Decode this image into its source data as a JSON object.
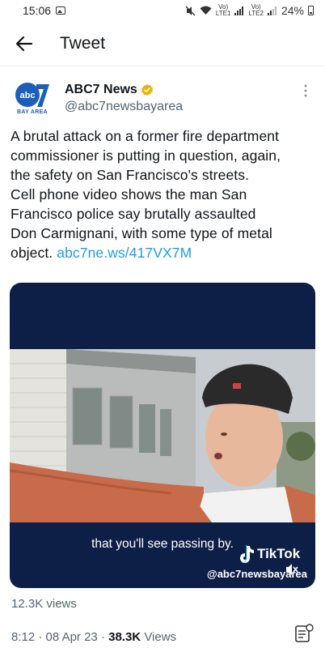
{
  "status_bar": {
    "time": "15:06",
    "lte1": "Vo)\nLTE1",
    "lte2": "Vo)\nLTE2",
    "battery": "24%"
  },
  "header": {
    "title": "Tweet"
  },
  "tweet": {
    "display_name": "ABC7 News",
    "handle": "@abc7newsbayarea",
    "avatar_caption": "BAY AREA",
    "avatar_logo_text": "abc",
    "text_lines": [
      "A brutal attack on a former fire department",
      "commissioner is putting in question, again,",
      "the safety on San Francisco's streets.",
      "Cell phone video shows the man San",
      "Francisco police say brutally assaulted",
      "Don Carmignani, with some type of metal"
    ],
    "text_last_prefix": "object. ",
    "link": "abc7ne.ws/417VX7M",
    "media": {
      "caption": "that you'll see passing by.",
      "watermark": "TikTok",
      "watermark_handle": "@abc7newsbayarea"
    },
    "views_line": "12.3K views",
    "meta": {
      "time": "8:12",
      "date": "08 Apr 23",
      "views_count": "38.3K",
      "views_label": "Views"
    }
  },
  "colors": {
    "link": "#1d9bf0",
    "verified": "#e8b400",
    "media_bg": "#0e1f47",
    "abc_blue": "#1d5fb8"
  }
}
